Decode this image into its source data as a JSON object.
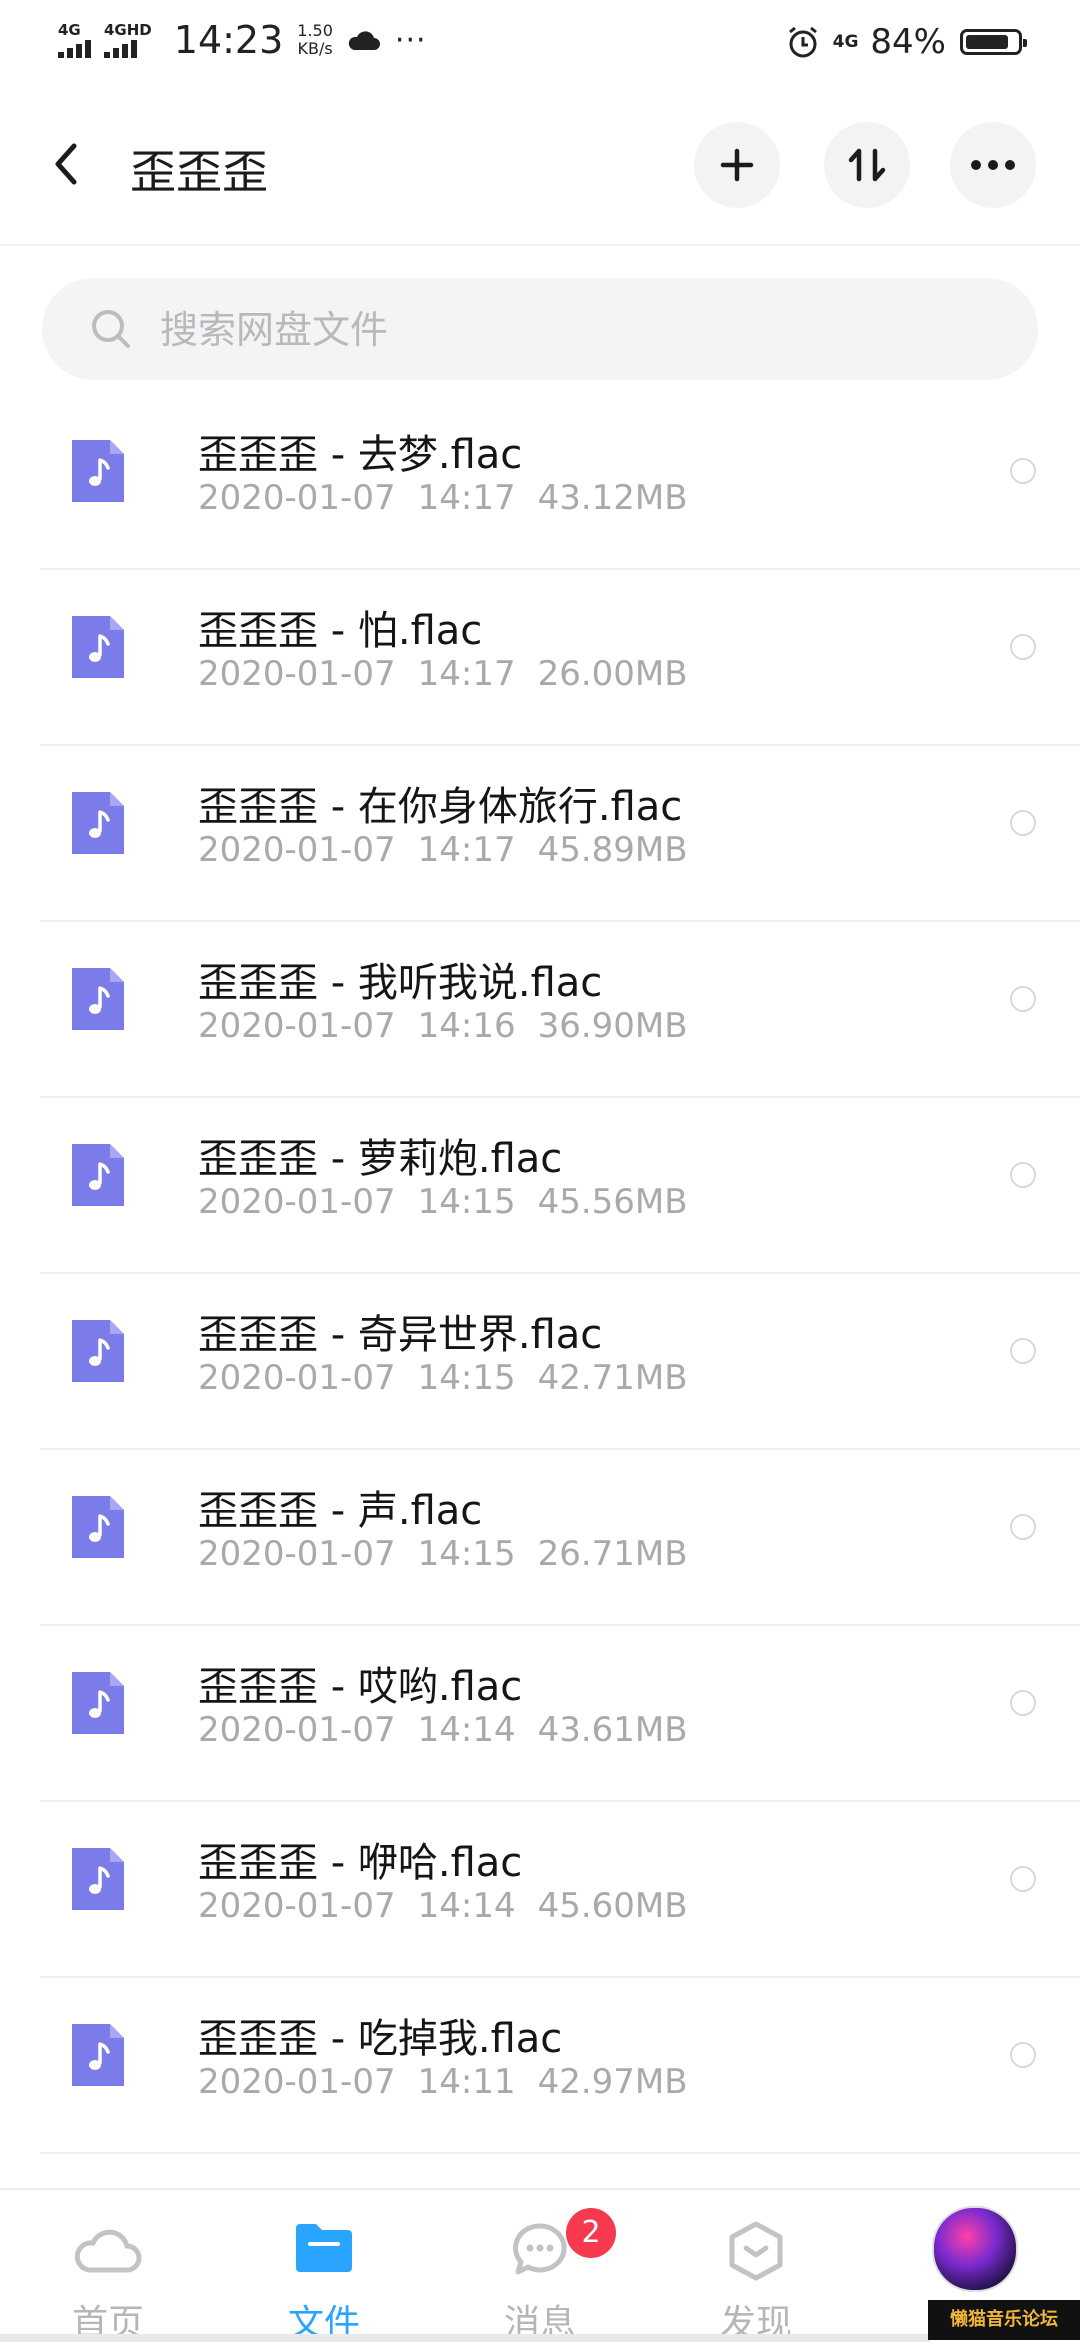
{
  "status_bar": {
    "sim1_label": "4G",
    "sim2_label": "4GHD",
    "time": "14:23",
    "speed_value": "1.50",
    "speed_unit": "KB/s",
    "more": "···",
    "network_right": "4G",
    "battery_text": "84%",
    "battery_level": 0.84
  },
  "header": {
    "title": "歪歪歪",
    "back_icon": "chevron-left-icon",
    "actions": [
      "plus-icon",
      "sort-icon",
      "more-icon"
    ]
  },
  "search": {
    "placeholder": "搜索网盘文件"
  },
  "files": [
    {
      "name": "歪歪歪 - 去梦.flac",
      "date": "2020-01-07",
      "time": "14:17",
      "size": "43.12MB"
    },
    {
      "name": "歪歪歪 - 怕.flac",
      "date": "2020-01-07",
      "time": "14:17",
      "size": "26.00MB"
    },
    {
      "name": "歪歪歪 - 在你身体旅行.flac",
      "date": "2020-01-07",
      "time": "14:17",
      "size": "45.89MB"
    },
    {
      "name": "歪歪歪 - 我听我说.flac",
      "date": "2020-01-07",
      "time": "14:16",
      "size": "36.90MB"
    },
    {
      "name": "歪歪歪 - 萝莉炮.flac",
      "date": "2020-01-07",
      "time": "14:15",
      "size": "45.56MB"
    },
    {
      "name": "歪歪歪 - 奇异世界.flac",
      "date": "2020-01-07",
      "time": "14:15",
      "size": "42.71MB"
    },
    {
      "name": "歪歪歪 - 声.flac",
      "date": "2020-01-07",
      "time": "14:15",
      "size": "26.71MB"
    },
    {
      "name": "歪歪歪 - 哎哟.flac",
      "date": "2020-01-07",
      "time": "14:14",
      "size": "43.61MB"
    },
    {
      "name": "歪歪歪 - 咿哈.flac",
      "date": "2020-01-07",
      "time": "14:14",
      "size": "45.60MB"
    },
    {
      "name": "歪歪歪 - 吃掉我.flac",
      "date": "2020-01-07",
      "time": "14:11",
      "size": "42.97MB"
    }
  ],
  "bottom_nav": {
    "items": [
      {
        "label": "首页",
        "icon": "cloud-icon"
      },
      {
        "label": "文件",
        "icon": "folder-icon"
      },
      {
        "label": "消息",
        "icon": "chat-icon"
      },
      {
        "label": "发现",
        "icon": "discover-icon"
      }
    ],
    "messages_badge": "2",
    "watermark": "懒猫音乐论坛"
  },
  "colors": {
    "accent": "#2aa5ff",
    "file_icon": "#7b7bea",
    "badge": "#f6394f",
    "muted_text": "#a9a9ad"
  }
}
